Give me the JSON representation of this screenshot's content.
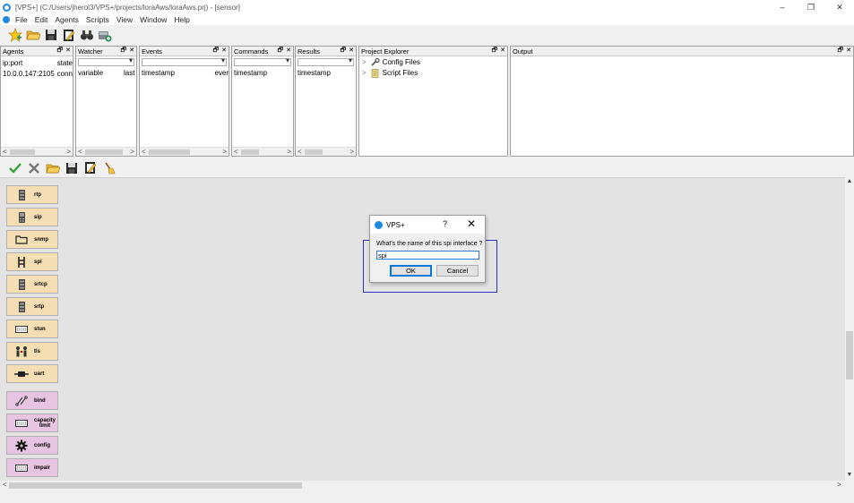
{
  "window": {
    "title": "[VPS+] (C:/Users/jherol3/VPS+/projects/loraAws/loraAws.prj) - [sensor]",
    "controls": [
      "–",
      "❐",
      "✕"
    ]
  },
  "menu": [
    "File",
    "Edit",
    "Agents",
    "Scripts",
    "View",
    "Window",
    "Help"
  ],
  "toolbar": [
    "star-icon",
    "folder-open-icon",
    "save-icon",
    "edit-document-icon",
    "binoculars-icon",
    "database-add-icon"
  ],
  "panels": {
    "agents": {
      "title": "Agents",
      "col1": "ip:port",
      "col2": "state",
      "row1_col1": "10.0.0.147:2105",
      "row1_col2": "conn"
    },
    "watcher": {
      "title": "Watcher",
      "col1": "variable",
      "col2": "last"
    },
    "events": {
      "title": "Events",
      "col1": "timestamp",
      "col2": "ever"
    },
    "commands": {
      "title": "Commands",
      "col1": "timestamp"
    },
    "results": {
      "title": "Results",
      "col1": "timestamp"
    },
    "project_explorer": {
      "title": "Project Explorer",
      "items": [
        "Config Files",
        "Script Files"
      ]
    },
    "output": {
      "title": "Output"
    },
    "head_buttons": {
      "float": "🗗",
      "close": "✕"
    },
    "scroll": {
      "left": "<",
      "right": ">"
    }
  },
  "toolbar2": [
    "check-icon",
    "cross-icon",
    "folder-open-icon",
    "save-icon",
    "edit-document-icon",
    "broom-icon"
  ],
  "palette": [
    {
      "label": "rtp",
      "kind": "proto",
      "icon": "device-icon"
    },
    {
      "label": "sip",
      "kind": "proto",
      "icon": "phone-icon"
    },
    {
      "label": "snmp",
      "kind": "proto",
      "icon": "folder-icon"
    },
    {
      "label": "spi",
      "kind": "proto",
      "icon": "spi-icon"
    },
    {
      "label": "srtcp",
      "kind": "proto",
      "icon": "device-icon"
    },
    {
      "label": "srtp",
      "kind": "proto",
      "icon": "device-icon"
    },
    {
      "label": "stun",
      "kind": "proto",
      "icon": "keyboard-icon"
    },
    {
      "label": "tls",
      "kind": "proto",
      "icon": "people-icon"
    },
    {
      "label": "uart",
      "kind": "proto",
      "icon": "cable-icon"
    },
    {
      "label": "bind",
      "kind": "func",
      "icon": "bind-icon"
    },
    {
      "label": "capacity limit",
      "kind": "func",
      "icon": "keyboard-icon"
    },
    {
      "label": "config",
      "kind": "func",
      "icon": "gear-icon"
    },
    {
      "label": "impair",
      "kind": "func",
      "icon": "keyboard-icon"
    }
  ],
  "dialog": {
    "title": "VPS+",
    "help": "?",
    "close": "✕",
    "prompt": "What's the name of this spi interface ?",
    "value": "spi",
    "ok": "OK",
    "cancel": "Cancel"
  },
  "colors": {
    "accent": "#1e88e5",
    "protocol_block": "#f5deb3",
    "function_block": "#e7c4e1",
    "selection": "#2b34c4"
  }
}
